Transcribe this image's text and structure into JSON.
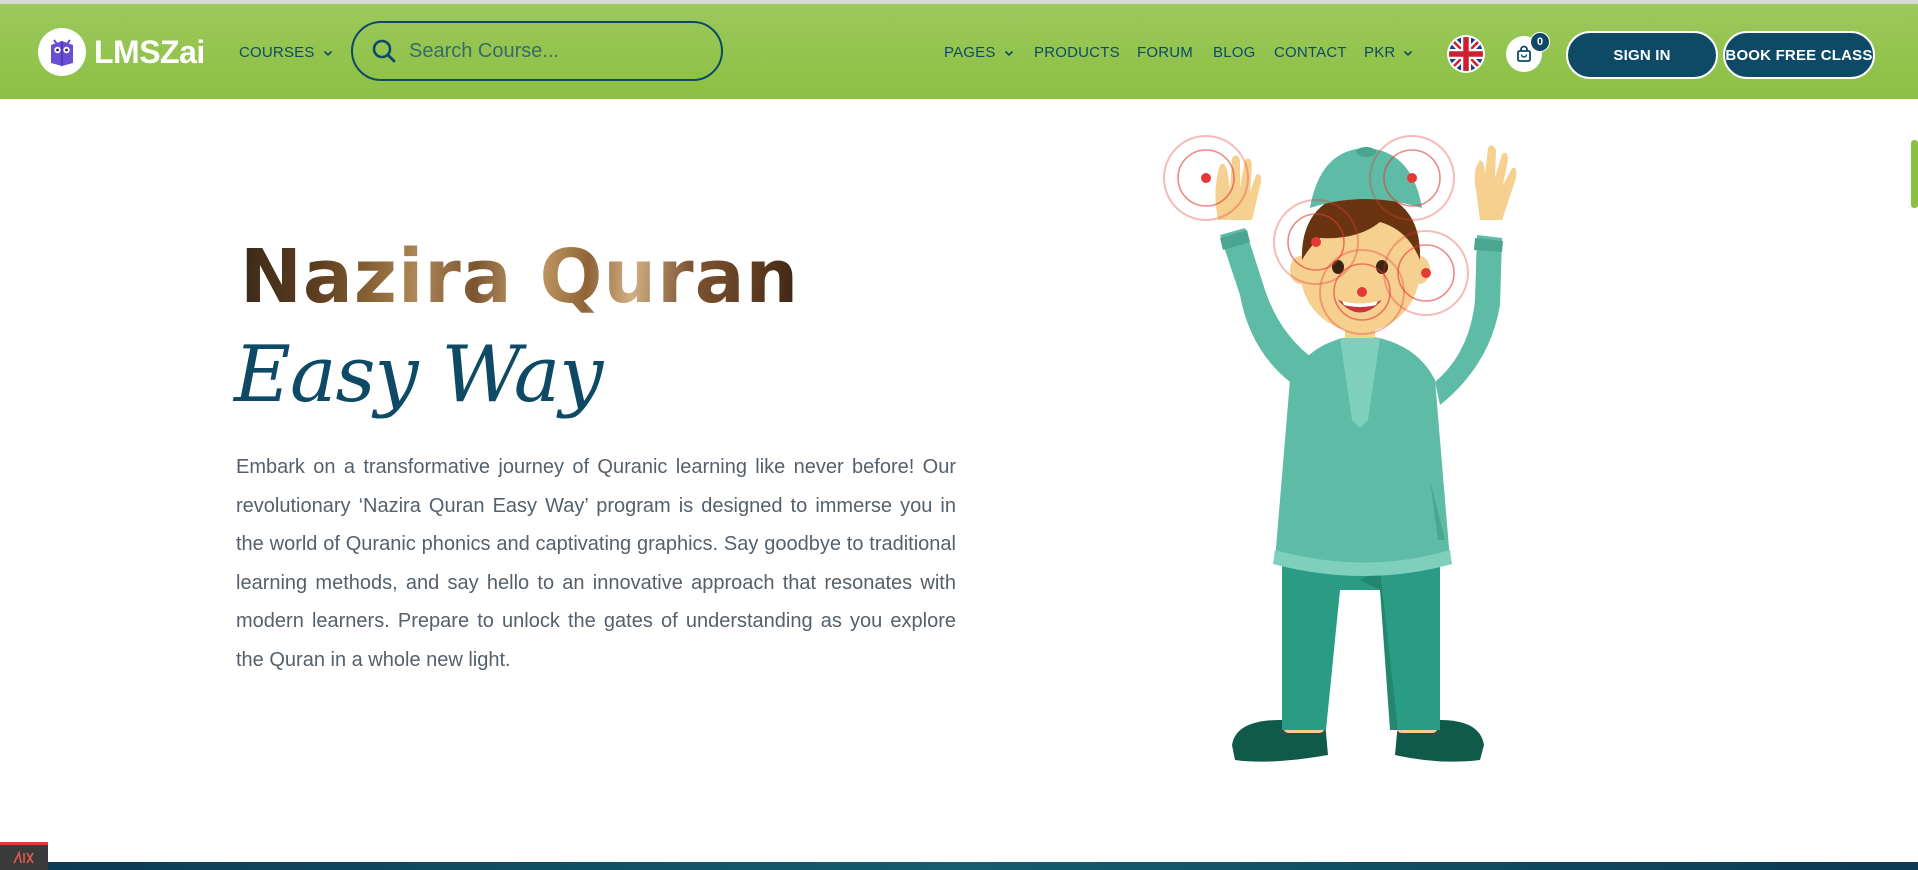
{
  "header": {
    "logo_text": "LMSZai",
    "courses_label": "COURSES",
    "search_placeholder": "Search Course...",
    "nav": {
      "pages": "PAGES",
      "products": "PRODUCTS",
      "forum": "FORUM",
      "blog": "BLOG",
      "contact": "CONTACT",
      "currency": "PKR"
    },
    "cart_count": "0",
    "signin_label": "SIGN IN",
    "book_label": "BOOK FREE CLASS"
  },
  "hero": {
    "title": "Nazira Quran",
    "subtitle": "Easy Way",
    "description": "Embark on a transformative journey of Quranic learning like never before! Our revolutionary ‘Nazira Quran Easy Way’ program is designed to immerse you in the world of Quranic phonics and captivating graphics. Say goodbye to traditional learning methods, and say hello to an innovative approach that resonates with modern learners. Prepare to unlock the gates of understanding as you explore the Quran in a whole new light."
  },
  "colors": {
    "navbar_green": "#8cc043",
    "brand_navy": "#0e4a66",
    "body_text": "#56606a",
    "hotspot_red": "#e53935",
    "kurta_teal": "#5dbba6"
  },
  "icons": {
    "logo": "owl-book-icon",
    "search": "search-icon",
    "flag": "uk-flag-icon",
    "cart": "shopping-bag-icon"
  }
}
